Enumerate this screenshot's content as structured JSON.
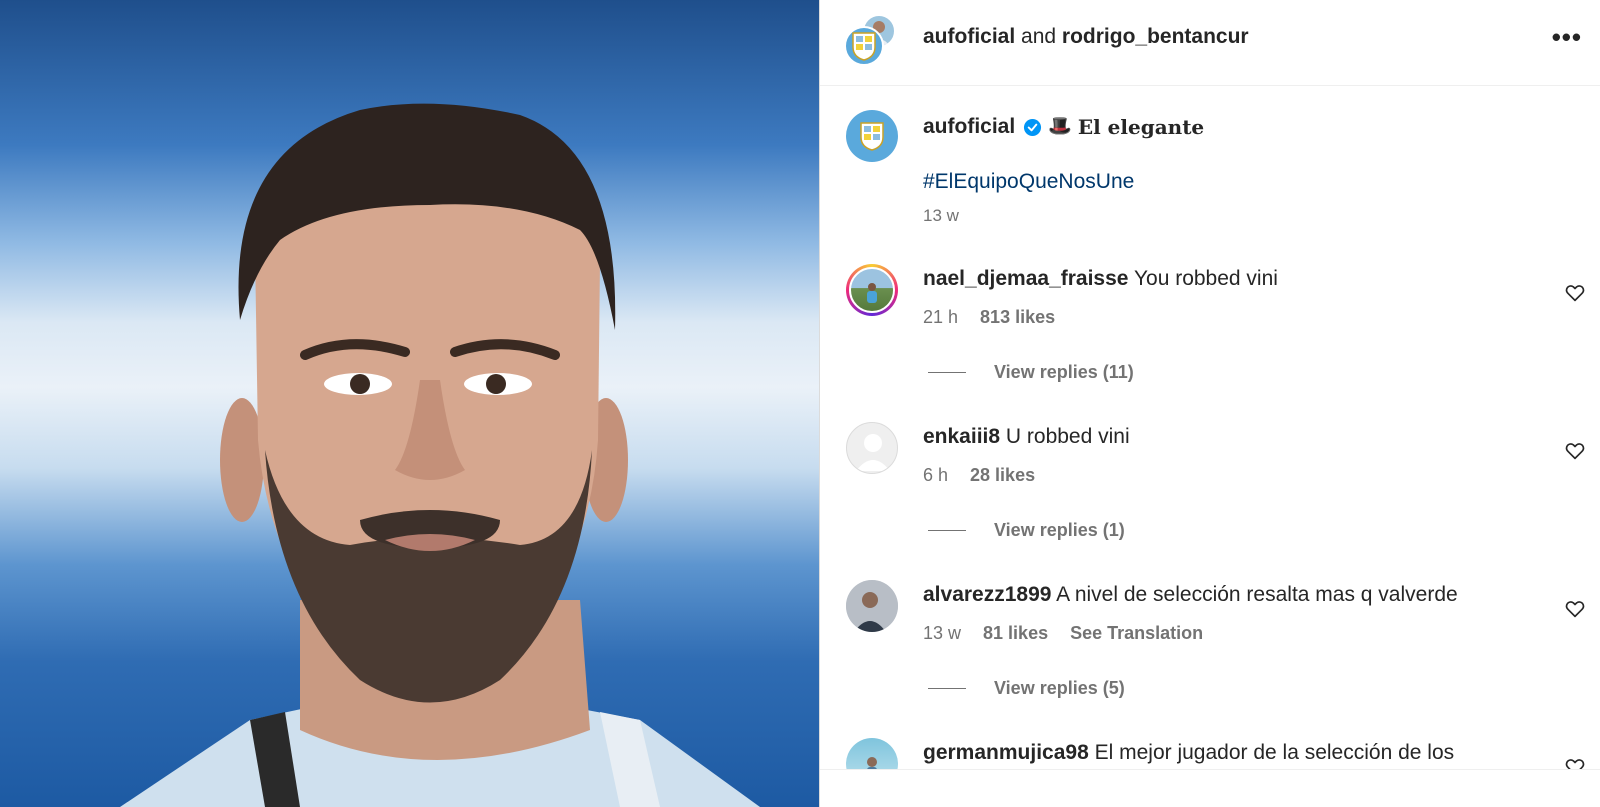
{
  "photo": {
    "alt_icon": "player-portrait-photo"
  },
  "header": {
    "user1": "aufoficial",
    "joiner": "and",
    "user2": "rodrigo_bentancur",
    "more": "•••"
  },
  "caption": {
    "username": "aufoficial",
    "hat": "🎩",
    "title": "El elegante",
    "hashtag": "#ElEquipoQueNosUne",
    "time": "13 w"
  },
  "comments": [
    {
      "user": "nael_djemaa_fraisse",
      "text": "You robbed vini",
      "time": "21 h",
      "likes": "813 likes",
      "replies": "View replies (11)"
    },
    {
      "user": "enkaiii8",
      "text": "U robbed vini",
      "time": "6 h",
      "likes": "28 likes",
      "replies": "View replies (1)"
    },
    {
      "user": "alvarezz1899",
      "text": "A nivel de selección resalta mas q valverde",
      "time": "13 w",
      "likes": "81 likes",
      "translation": "See Translation",
      "replies": "View replies (5)"
    },
    {
      "user": "germanmujica98",
      "text": "El mejor jugador de la selección de los"
    }
  ],
  "colors": {
    "link": "#00376b",
    "secondary": "#737373",
    "verified": "#0095f6",
    "avatar_blue": "#5aa9dc"
  }
}
